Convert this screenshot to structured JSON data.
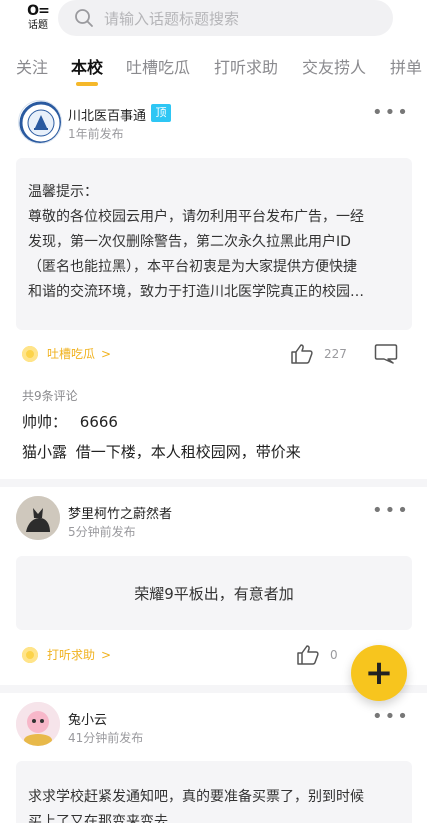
{
  "header": {
    "topic_label": "话题",
    "search_placeholder": "请输入话题标题搜索"
  },
  "tabs": [
    {
      "label": "关注",
      "active": false
    },
    {
      "label": "本校",
      "active": true
    },
    {
      "label": "吐槽吃瓜",
      "active": false
    },
    {
      "label": "打听求助",
      "active": false
    },
    {
      "label": "交友捞人",
      "active": false
    },
    {
      "label": "拼单",
      "active": false
    }
  ],
  "posts": [
    {
      "author": "川北医百事通",
      "pinned_label": "顶",
      "time": "1年前发布",
      "more": "•••",
      "content_lines": [
        "温馨提示：",
        "尊敬的各位校园云用户，请勿利用平台发布广告，一经",
        "发现，第一次仅删除警告，第二次永久拉黑此用户ID",
        "（匿名也能拉黑），本平台初衷是为大家提供方便快捷",
        "和谐的交流环境，致力于打造川北医学院真正的校园…"
      ],
      "tag": "吐槽吃瓜",
      "likes": "227",
      "comment_summary": "共9条评论",
      "comments": [
        {
          "author": "帅帅：",
          "text": "6666"
        },
        {
          "author": "猫小露",
          "text": "借一下楼，本人租校园网，带价来"
        }
      ]
    },
    {
      "author": "梦里柯竹之蔚然者",
      "time": "5分钟前发布",
      "more": "•••",
      "content": "荣耀9平板出，有意者加",
      "tag": "打听求助",
      "likes": "0"
    },
    {
      "author": "兔小云",
      "time": "41分钟前发布",
      "more": "•••",
      "content_lines": [
        "求求学校赶紧发通知吧，真的要准备买票了，别到时候",
        "买上了又在那变来变去"
      ]
    }
  ],
  "fab": {
    "label": "+",
    "color": "#f7c51e"
  },
  "colors": {
    "accent": "#f5b82a",
    "tag": "#f0b21f",
    "pin": "#2ec6f4"
  }
}
